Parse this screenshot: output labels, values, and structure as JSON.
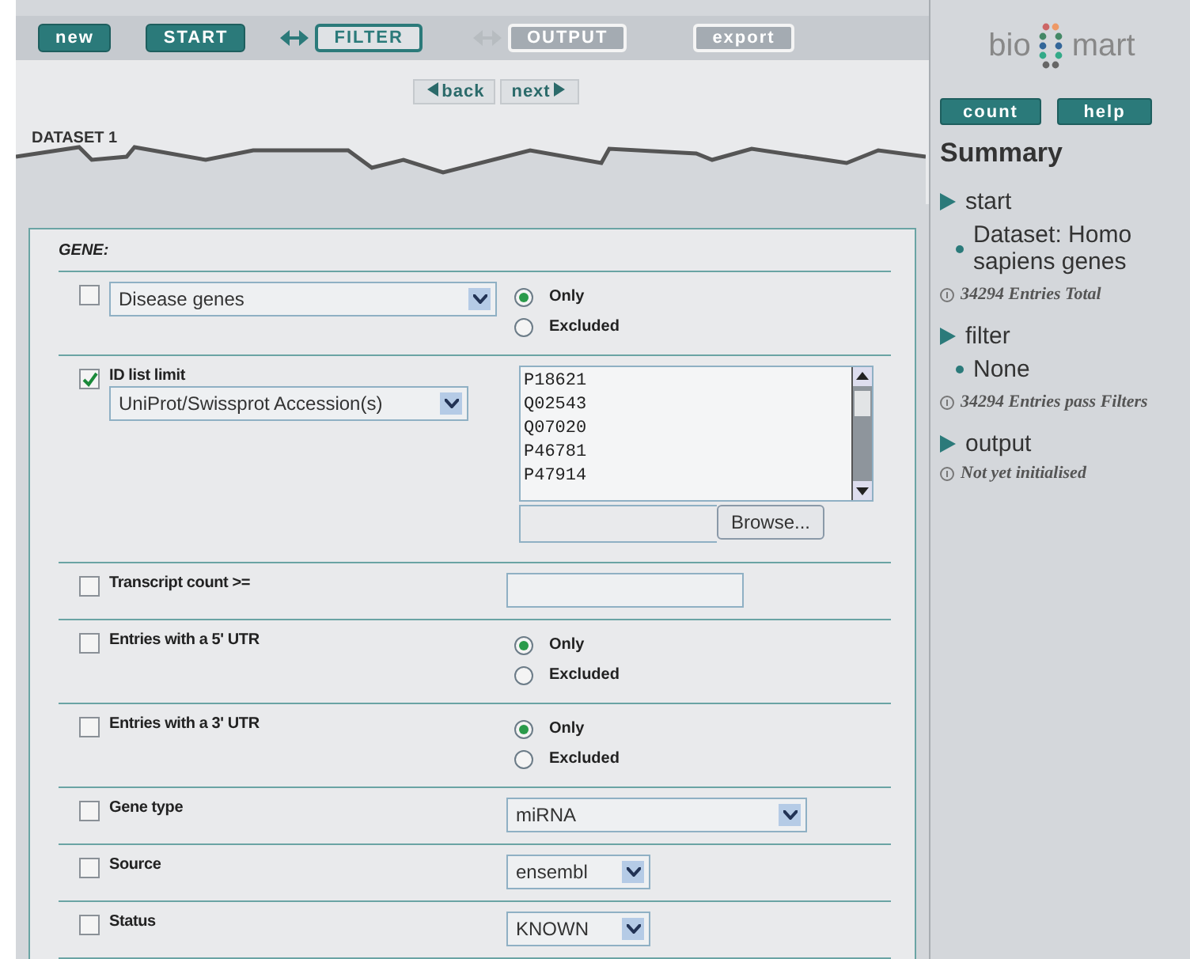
{
  "nav": [
    {
      "label": "new",
      "kind": "filled"
    },
    {
      "label": "START",
      "kind": "filled"
    },
    {
      "kind": "arrow",
      "enabled": true
    },
    {
      "label": "FILTER",
      "kind": "outlined"
    },
    {
      "kind": "arrow",
      "enabled": false
    },
    {
      "label": "OUTPUT",
      "kind": "disabled"
    },
    {
      "label": "export",
      "kind": "disabled"
    }
  ],
  "pager": {
    "back": "back",
    "next": "next"
  },
  "dataset_title": "DATASET 1",
  "section": "GENE:",
  "filters": [
    {
      "kind": "select_radio",
      "checked": false,
      "select": "Disease genes",
      "options": [
        {
          "label": "Only",
          "selected": true
        },
        {
          "label": "Excluded",
          "selected": false
        }
      ]
    },
    {
      "kind": "id_list",
      "checked": true,
      "label": "ID list limit",
      "select": "UniProt/Swissprot Accession(s)",
      "ids": [
        "P18621",
        "Q02543",
        "Q07020",
        "P46781",
        "P47914"
      ],
      "browse": "Browse..."
    },
    {
      "kind": "text",
      "checked": false,
      "label": "Transcript count >="
    },
    {
      "kind": "radio",
      "checked": false,
      "label": "Entries with a 5' UTR",
      "options": [
        {
          "label": "Only",
          "selected": true
        },
        {
          "label": "Excluded",
          "selected": false
        }
      ]
    },
    {
      "kind": "radio",
      "checked": false,
      "label": "Entries with a 3' UTR",
      "options": [
        {
          "label": "Only",
          "selected": true
        },
        {
          "label": "Excluded",
          "selected": false
        }
      ]
    },
    {
      "kind": "wide_select",
      "checked": false,
      "label": "Gene type",
      "select": "miRNA"
    },
    {
      "kind": "select",
      "checked": false,
      "label": "Source",
      "select": "ensembl"
    },
    {
      "kind": "select",
      "checked": false,
      "label": "Status",
      "select": "KNOWN"
    }
  ],
  "sidebar": {
    "logo_left": "bio",
    "logo_right": "mart",
    "buttons": [
      "count",
      "help"
    ],
    "title": "Summary",
    "sections": [
      {
        "heading": "start",
        "items": [
          "Dataset: Homo sapiens genes"
        ],
        "note": "34294 Entries Total"
      },
      {
        "heading": "filter",
        "items": [
          "None"
        ],
        "note": "34294 Entries pass Filters"
      },
      {
        "heading": "output",
        "note": "Not yet initialised"
      }
    ]
  }
}
